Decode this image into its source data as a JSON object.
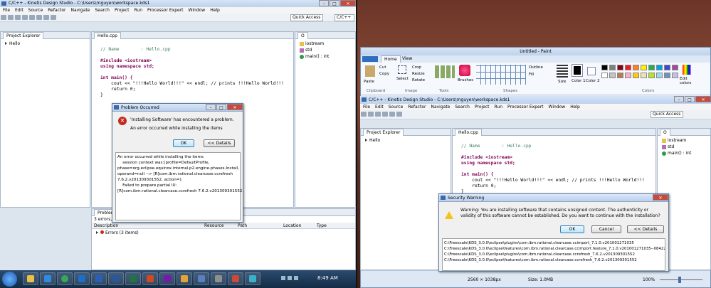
{
  "left_window": {
    "title": "C/C++ - Kinetis Design Studio - C:\\Users\\rnguyen\\workspace.kds1",
    "menu": [
      "File",
      "Edit",
      "Source",
      "Refactor",
      "Navigate",
      "Search",
      "Project",
      "Run",
      "Processor Expert",
      "Window",
      "Help"
    ],
    "quick_access": "Quick Access",
    "perspective": "C/C++",
    "project_explorer": {
      "tab": "Project Explorer",
      "items": [
        "Hello"
      ]
    },
    "editor": {
      "tab": "Hello.cpp",
      "lines": [
        {
          "t": "cmt",
          "v": "// Name        : Hello.cpp"
        },
        {
          "t": "kw",
          "v": "#include <iostream>"
        },
        {
          "t": "kw",
          "v": "using namespace std;"
        },
        {
          "t": "plain",
          "v": ""
        },
        {
          "t": "kw",
          "v": "int main() {"
        },
        {
          "t": "plain",
          "v": "    cout << \"!!!Hello World!!!\" << endl; // prints !!!Hello World!!!"
        },
        {
          "t": "plain",
          "v": "    return 0;"
        },
        {
          "t": "plain",
          "v": "}"
        }
      ]
    },
    "outline": {
      "items": [
        "iostream",
        "std",
        "main() : int"
      ]
    },
    "problems": {
      "tab": "Problem",
      "count": "3 errors, 0 warnings, 0",
      "columns": [
        "Description",
        "Resource",
        "Path",
        "Location",
        "Type"
      ],
      "row": "Errors (3 items)"
    }
  },
  "problem_dialog": {
    "title": "Problem Occurred",
    "message": "'Installing Software' has encountered a problem.",
    "submessage": "An error occurred while installing the items",
    "ok": "OK",
    "details": "<< Details",
    "detail_text": [
      "An error occurred while installing the items",
      "    session context was:(profile=DefaultProfile,",
      "phase=org.eclipse.equinox.internal.p2.engine.phases.Install,",
      "operand=null --> [R]com.ibm.rational.clearcase.ccrefresh",
      "7.6.2.v201309301552, action=).",
      "    Failed to prepare partial IU:",
      "[R]com.ibm.rational.clearcase.ccrefresh 7.6.2.v201309301552."
    ]
  },
  "clock": "8:49 AM",
  "paint": {
    "title": "Untitled - Paint",
    "tabs": [
      "Home",
      "View"
    ],
    "groups": [
      "Clipboard",
      "Image",
      "Tools",
      "Shapes",
      "Colors"
    ],
    "buttons": {
      "paste": "Paste",
      "cut": "Cut",
      "copy": "Copy",
      "select": "Select",
      "crop": "Crop",
      "resize": "Resize",
      "rotate": "Rotate",
      "brushes": "Brushes",
      "outline": "Outline",
      "fill": "Fill",
      "size": "Size",
      "color1": "Color 1",
      "color2": "Color 2",
      "edit_colors": "Edit colors"
    },
    "status": {
      "dims": "2560 × 1038px",
      "size": "Size: 1.0MB",
      "zoom": "100%"
    }
  },
  "right_window": {
    "title": "C/C++ - Kinetis Design Studio - C:\\Users\\rnguyen\\workspace.kds1",
    "menu": [
      "File",
      "Edit",
      "Source",
      "Refactor",
      "Navigate",
      "Search",
      "Project",
      "Run",
      "Processor Expert",
      "Window",
      "Help"
    ],
    "quick_access": "Quick Access",
    "project_explorer": {
      "tab": "Project Explorer",
      "items": [
        "Hello"
      ]
    },
    "editor": {
      "tab": "Hello.cpp"
    },
    "outline": {
      "tab": "O",
      "items": [
        "iostream",
        "std",
        "main() : int"
      ]
    }
  },
  "security_dialog": {
    "title": "Security Warning",
    "message": "Warning: You are installing software that contains unsigned content. The authenticity or validity of this software cannot be established. Do you want to continue with the installation?",
    "ok": "OK",
    "cancel": "Cancel",
    "details": "<< Details",
    "items": [
      "C:\\Freescale\\KDS_3.0.0\\eclipse\\plugins\\com.ibm.rational.clearcase.ccimport_7.1.0.v201001271035",
      "C:\\Freescale\\KDS_3.0.0\\eclipse\\features\\com.ibm.rational.clearcase.ccimport.feature_7.1.0.v201001271035--08422A2_",
      "C:\\Freescale\\KDS_3.0.0\\eclipse\\plugins\\com.ibm.rational.clearcase.ccrefresh_7.6.2.v201309301552",
      "C:\\Freescale\\KDS_3.0.0\\eclipse\\features\\com.ibm.rational.clearcase.ccrefresh_7.6.2.v201309301552"
    ]
  },
  "colors": {
    "accent": "#3c7fb1",
    "error": "#c42b1c",
    "palette": [
      "#000000",
      "#7f7f7f",
      "#880015",
      "#ed1c24",
      "#ff7f27",
      "#fff200",
      "#22b14c",
      "#00a2e8",
      "#3f48cc",
      "#a349a4",
      "#ffffff",
      "#c3c3c3",
      "#b97a57",
      "#ffaec9",
      "#ffc90e",
      "#efe4b0",
      "#b5e61d",
      "#99d9ea",
      "#7092be",
      "#c8bfe7"
    ]
  }
}
